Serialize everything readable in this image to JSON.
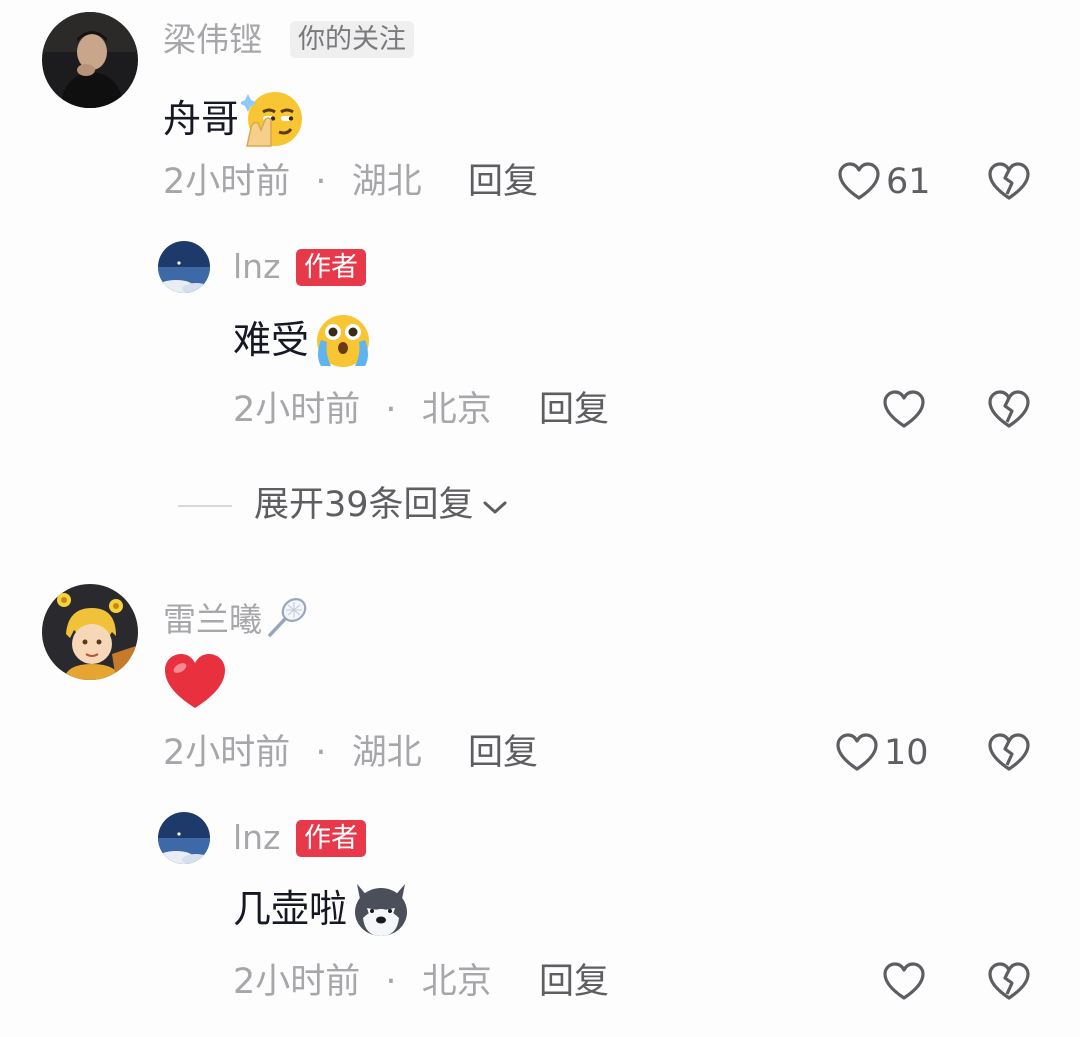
{
  "comments": [
    {
      "username": "梁伟铿",
      "badge": "你的关注",
      "text": "舟哥",
      "emoji": "smirk-shush-emoji",
      "time": "2小时前",
      "location": "湖北",
      "reply_label": "回复",
      "likes": "61",
      "replies": [
        {
          "username": "lnz",
          "badge": "作者",
          "text": "难受",
          "emoji": "teary-face-emoji",
          "time": "2小时前",
          "location": "北京",
          "reply_label": "回复"
        }
      ],
      "expand_label": "展开39条回复"
    },
    {
      "username": "雷兰曦",
      "username_emoji": "badminton-racket-emoji",
      "text": "",
      "emoji": "red-heart-emoji",
      "time": "2小时前",
      "location": "湖北",
      "reply_label": "回复",
      "likes": "10",
      "replies": [
        {
          "username": "lnz",
          "badge": "作者",
          "text": "几壶啦",
          "emoji": "husky-dog-emoji",
          "time": "2小时前",
          "location": "北京",
          "reply_label": "回复"
        }
      ]
    }
  ],
  "separator": "·",
  "colors": {
    "accent": "#e8394a",
    "muted": "#a7a7ab",
    "text": "#161823"
  }
}
